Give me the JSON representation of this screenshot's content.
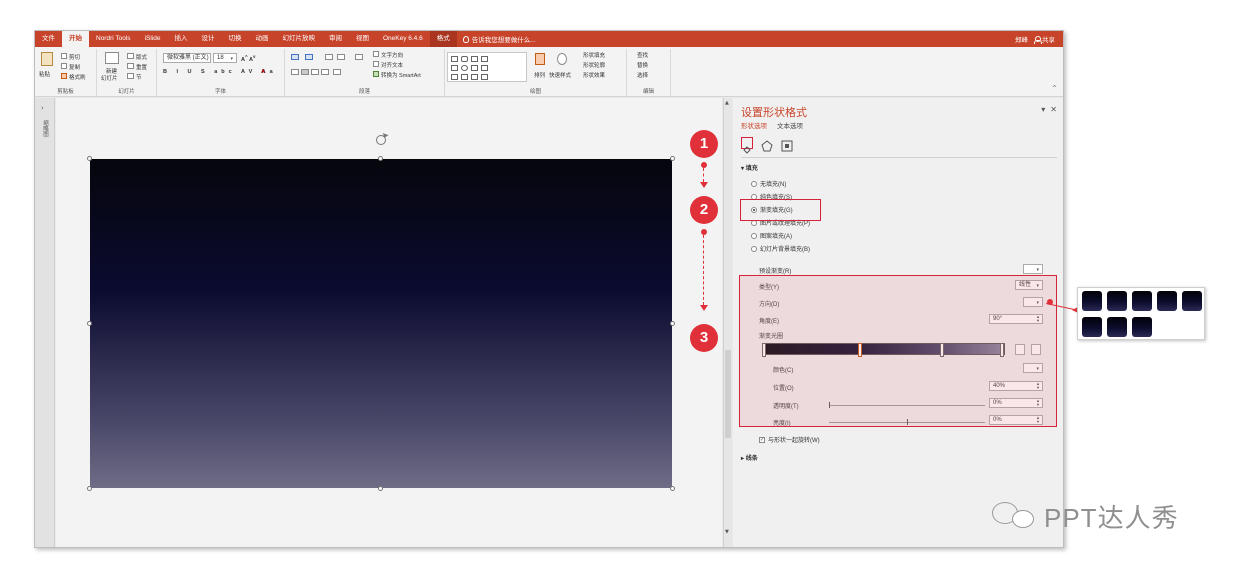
{
  "tabs": [
    "文件",
    "开始",
    "Nordri Tools",
    "iSlide",
    "插入",
    "设计",
    "切换",
    "动画",
    "幻灯片放映",
    "审阅",
    "视图",
    "OneKey 6.4.6",
    "格式"
  ],
  "active_tab": "开始",
  "tell_me": "告诉我您想要做什么...",
  "user": "郑峰",
  "share": "共享",
  "ribbon": {
    "clipboard": {
      "label": "剪贴板",
      "paste": "粘贴",
      "cut": "剪切",
      "copy": "复制",
      "format_painter": "格式刷"
    },
    "slides": {
      "label": "幻灯片",
      "new": "新建",
      "new2": "幻灯片",
      "layout": "版式",
      "reset": "重置",
      "section": "节"
    },
    "font": {
      "label": "字体",
      "font_name": "微软雅黑 (正文)",
      "font_size": "18",
      "font_size_caret": "▾"
    },
    "paragraph": {
      "label": "段落",
      "text_direction": "文字方向",
      "align_text": "对齐文本",
      "smartart": "转换为 SmartArt"
    },
    "drawing": {
      "label": "绘图",
      "arrange": "排列",
      "quick_styles": "快速样式",
      "fill": "形状填充",
      "outline": "形状轮廓",
      "effects": "形状效果"
    },
    "editing": {
      "label": "编辑",
      "find": "查找",
      "replace": "替换",
      "select": "选择"
    }
  },
  "left_strip": {
    "label": "缩略图"
  },
  "pane": {
    "title": "设置形状格式",
    "tab_shape": "形状选项",
    "tab_text": "文本选项",
    "section_fill": "填充",
    "fill_options": [
      {
        "label": "无填充(N)",
        "selected": false
      },
      {
        "label": "纯色填充(S)",
        "selected": false
      },
      {
        "label": "渐变填充(G)",
        "selected": true
      },
      {
        "label": "图片或纹理填充(P)",
        "selected": false
      },
      {
        "label": "图案填充(A)",
        "selected": false
      },
      {
        "label": "幻灯片背景填充(B)",
        "selected": false
      }
    ],
    "preset_label": "预设渐变(R)",
    "type_label": "类型(Y)",
    "type_value": "线性",
    "direction_label": "方向(D)",
    "angle_label": "角度(E)",
    "angle_value": "90°",
    "stops_label": "渐变光圈",
    "color_label": "颜色(C)",
    "position_label": "位置(O)",
    "position_value": "40%",
    "transparency_label": "透明度(T)",
    "transparency_value": "0%",
    "brightness_label": "亮度(I)",
    "brightness_value": "0%",
    "rotate_with_shape": "与形状一起旋转(W)",
    "section_line": "线条"
  },
  "steps": [
    "1",
    "2",
    "3"
  ],
  "brand": "PPT达人秀",
  "colors": {
    "accent": "#c7432a",
    "badge": "#e0303a",
    "highlight": "#d4243a"
  }
}
